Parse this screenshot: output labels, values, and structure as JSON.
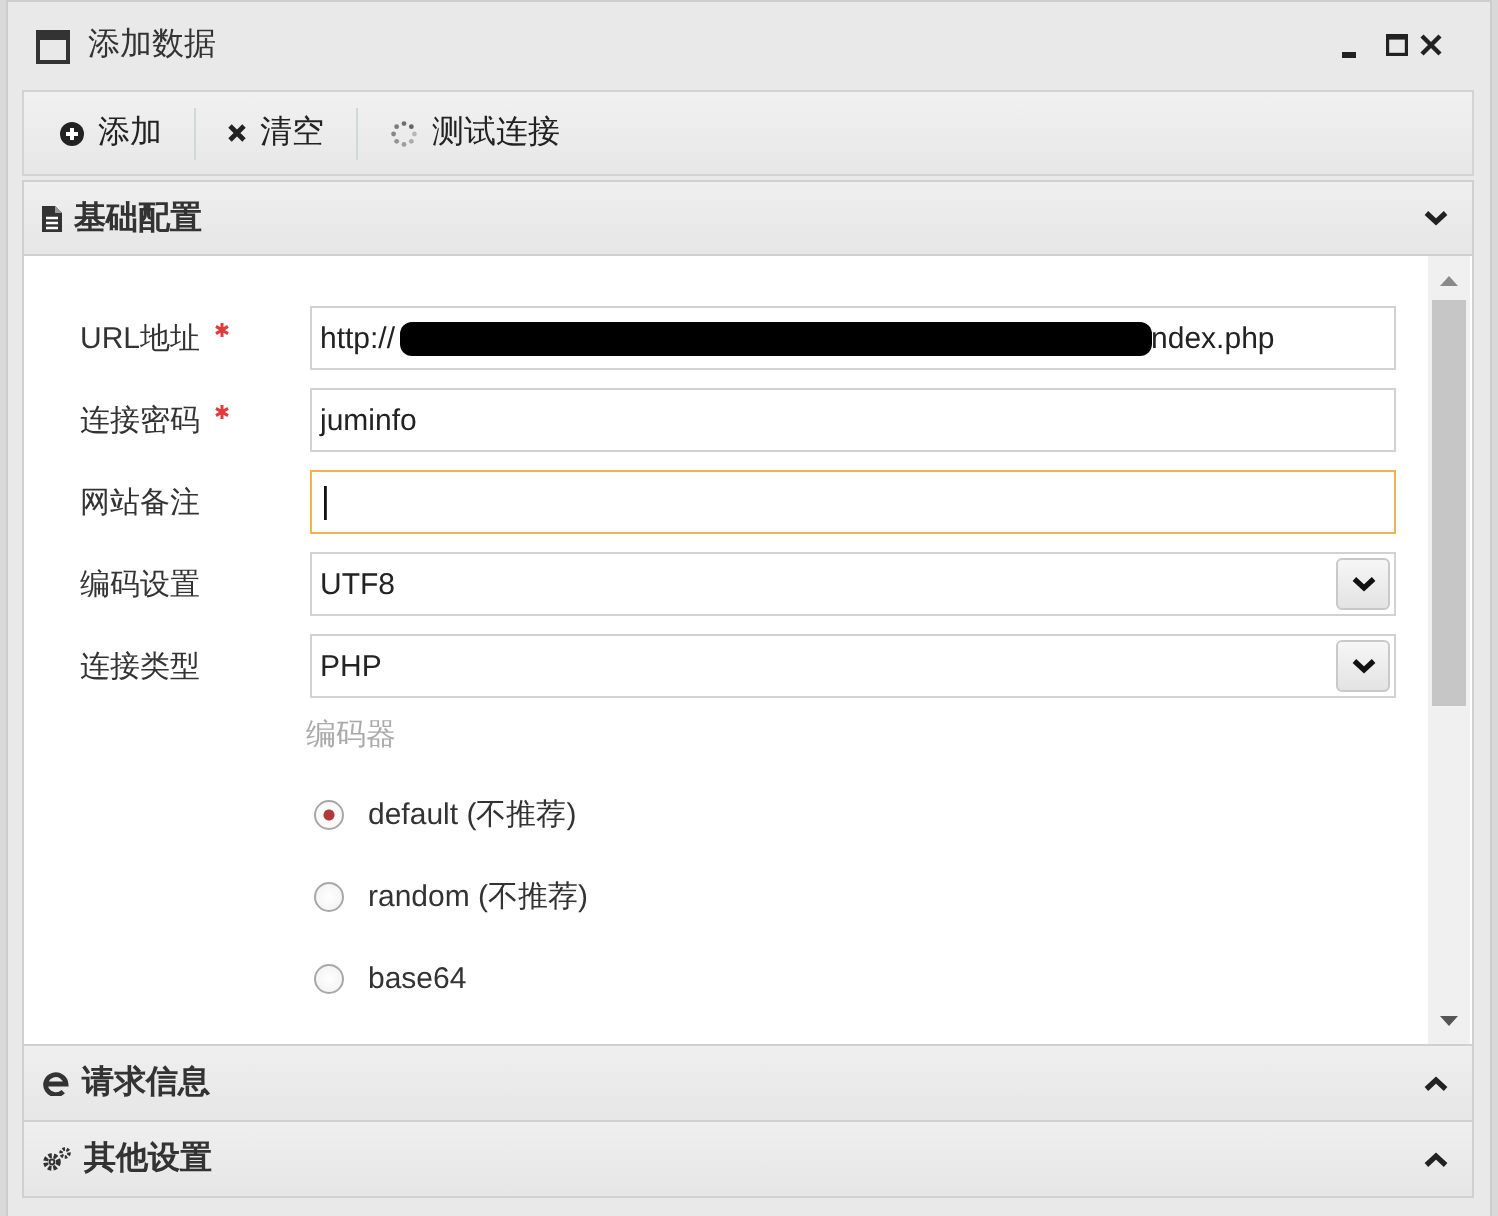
{
  "window": {
    "title": "添加数据"
  },
  "toolbar": [
    {
      "kind": "add",
      "label": "添加"
    },
    {
      "kind": "clear",
      "label": "清空"
    },
    {
      "kind": "test",
      "label": "测试连接"
    }
  ],
  "sections": [
    {
      "kind": "basic",
      "title": "基础配置",
      "expanded": true,
      "form": {
        "fields": [
          {
            "kind": "text",
            "label": "URL地址",
            "required": true,
            "focused": false,
            "value_start": "http://",
            "redacted": true,
            "value_end": "ndex.php"
          },
          {
            "kind": "text",
            "label": "连接密码",
            "required": true,
            "focused": false,
            "value": "juminfo"
          },
          {
            "kind": "text",
            "label": "网站备注",
            "required": false,
            "focused": true
          },
          {
            "kind": "select",
            "label": "编码设置",
            "required": false,
            "focused": false,
            "value": "UTF8"
          },
          {
            "kind": "select",
            "label": "连接类型",
            "required": false,
            "focused": false,
            "value": "PHP"
          }
        ],
        "encoder": {
          "label": "编码器",
          "options": [
            {
              "label": "default (不推荐)",
              "selected": true
            },
            {
              "label": "random (不推荐)",
              "selected": false
            },
            {
              "label": "base64",
              "selected": false
            }
          ]
        }
      }
    },
    {
      "kind": "request",
      "title": "请求信息",
      "expanded": false
    },
    {
      "kind": "other",
      "title": "其他设置",
      "expanded": false
    }
  ]
}
